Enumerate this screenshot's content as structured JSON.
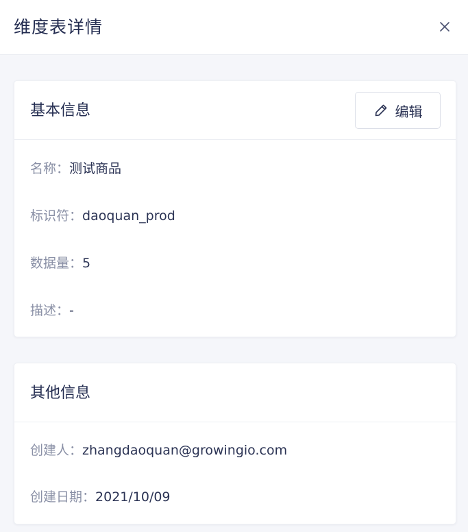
{
  "drawer": {
    "title": "维度表详情",
    "close_icon": "close-icon"
  },
  "basic_info": {
    "title": "基本信息",
    "edit_label": "编辑",
    "edit_icon": "pencil-icon",
    "fields": [
      {
        "label": "名称：",
        "value": "测试商品"
      },
      {
        "label": "标识符：",
        "value": "daoquan_prod"
      },
      {
        "label": "数据量：",
        "value": "5"
      },
      {
        "label": "描述：",
        "value": "-"
      }
    ]
  },
  "other_info": {
    "title": "其他信息",
    "fields": [
      {
        "label": "创建人：",
        "value": "zhangdaoquan@growingio.com"
      },
      {
        "label": "创建日期：",
        "value": "2021/10/09"
      }
    ]
  }
}
